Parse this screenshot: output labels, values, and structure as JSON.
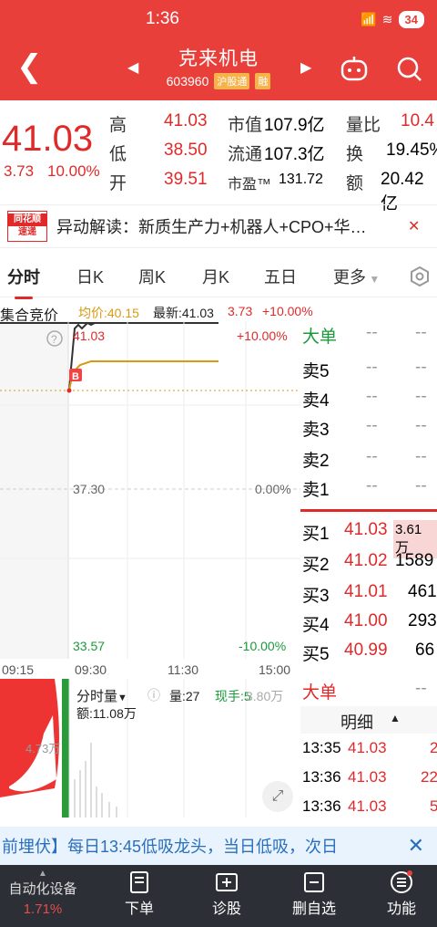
{
  "status": {
    "time": "1:36",
    "battery": "34"
  },
  "header": {
    "name": "克来机电",
    "code": "603960",
    "tag1": "沪股通",
    "tag2": "融"
  },
  "quote": {
    "price": "41.03",
    "change": "3.73",
    "change_pct": "10.00%",
    "rows": [
      {
        "l1": "高",
        "v1": "41.03",
        "l2": "市值",
        "v2": "107.9亿",
        "l3": "量比",
        "v3": "10.4"
      },
      {
        "l1": "低",
        "v1": "38.50",
        "l2": "流通",
        "v2": "107.3亿",
        "l3": "换",
        "v3": "19.45%"
      },
      {
        "l1": "开",
        "v1": "39.51",
        "l2": "市盈™",
        "v2": "131.72",
        "l3": "额",
        "v3": "20.42亿"
      }
    ]
  },
  "news": {
    "logo_top": "同花顺",
    "logo_bottom": "速递",
    "text": "异动解读：新质生产力+机器人+CPO+华…"
  },
  "tabs": [
    "分时",
    "日K",
    "周K",
    "月K",
    "五日",
    "更多"
  ],
  "chart_info": {
    "auction": "集合竞价",
    "avg": "均价:40.15",
    "latest": "最新:41.03",
    "chg": "3.73",
    "pct": "+10.00%"
  },
  "axis": {
    "top_price": "41.03",
    "top_pct": "+10.00%",
    "mid_price": "37.30",
    "mid_pct": "0.00%",
    "low_price": "33.57",
    "low_pct": "-10.00%",
    "t0": "09:15",
    "t1": "09:30",
    "t2": "11:30",
    "t3": "15:00",
    "buy_marker": "B"
  },
  "orderbook": {
    "big_label": "大单",
    "big_v1": "--",
    "big_v2": "--",
    "sells": [
      {
        "label": "卖5",
        "p": "--",
        "v": "--"
      },
      {
        "label": "卖4",
        "p": "--",
        "v": "--"
      },
      {
        "label": "卖3",
        "p": "--",
        "v": "--"
      },
      {
        "label": "卖2",
        "p": "--",
        "v": "--"
      },
      {
        "label": "卖1",
        "p": "--",
        "v": "--"
      }
    ],
    "buys": [
      {
        "label": "买1",
        "p": "41.03",
        "v": "3.61万"
      },
      {
        "label": "买2",
        "p": "41.02",
        "v": "1589"
      },
      {
        "label": "买3",
        "p": "41.01",
        "v": "461"
      },
      {
        "label": "买4",
        "p": "41.00",
        "v": "293"
      },
      {
        "label": "买5",
        "p": "40.99",
        "v": "66"
      }
    ]
  },
  "volume": {
    "label": "分时量",
    "qty": "量:27",
    "hand": "现手:5",
    "amount": "额:11.08万",
    "left_label": "4.73万",
    "max": "3.80万"
  },
  "detail": {
    "big_label": "大单",
    "big_v": "--",
    "header": "明细",
    "rows": [
      {
        "t": "13:35",
        "p": "41.03",
        "v": "2"
      },
      {
        "t": "13:36",
        "p": "41.03",
        "v": "22"
      },
      {
        "t": "13:36",
        "p": "41.03",
        "v": "5"
      }
    ]
  },
  "banner": {
    "text": "前埋伏】每日13:45低吸龙头，当日低吸，次日"
  },
  "bottom": {
    "first_name": "自动化设备",
    "first_pct": "1.71%",
    "items": [
      "下单",
      "诊股",
      "删自选",
      "功能"
    ]
  }
}
